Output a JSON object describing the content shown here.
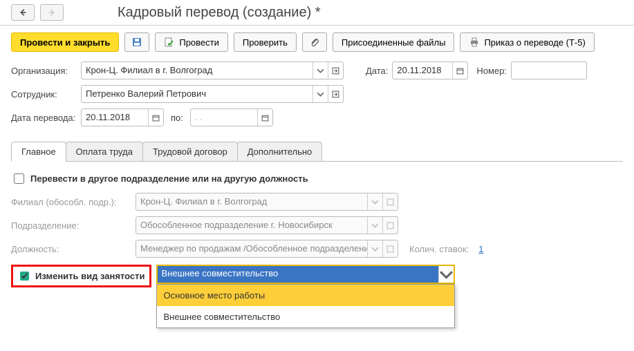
{
  "header": {
    "title": "Кадровый перевод (создание) *"
  },
  "toolbar": {
    "post_and_close": "Провести и закрыть",
    "post": "Провести",
    "check": "Проверить",
    "attached": "Присоединенные файлы",
    "order": "Приказ о переводе (Т-5)"
  },
  "fields": {
    "org_label": "Организация:",
    "org_value": "Крон-Ц. Филиал в г. Волгоград",
    "date_label": "Дата:",
    "date_value": "20.11.2018",
    "number_label": "Номер:",
    "number_value": "",
    "employee_label": "Сотрудник:",
    "employee_value": "Петренко Валерий Петрович",
    "transfer_date_label": "Дата перевода:",
    "transfer_date_value": "20.11.2018",
    "to_label": "по:",
    "to_value": "   .   .   "
  },
  "tabs": {
    "main": "Главное",
    "pay": "Оплата труда",
    "contract": "Трудовой договор",
    "extra": "Дополнительно"
  },
  "main_tab": {
    "chk_transfer": "Перевести в другое подразделение или на другую должность",
    "branch_label": "Филиал (обособл. подр.):",
    "branch_value": "Крон-Ц. Филиал в г. Волгоград",
    "dept_label": "Подразделение:",
    "dept_value": "Обособленное подразделение г. Новосибирск",
    "position_label": "Должность:",
    "position_value": "Менеджер по продажам /Обособленное подразделение г. Н",
    "rates_label": "Колич. ставок:",
    "rates_value": "1",
    "chk_change_emp": "Изменить вид занятости",
    "emp_value": "Внешнее совместительство",
    "dd_option1": "Основное место работы",
    "dd_option2": "Внешнее совместительство"
  }
}
